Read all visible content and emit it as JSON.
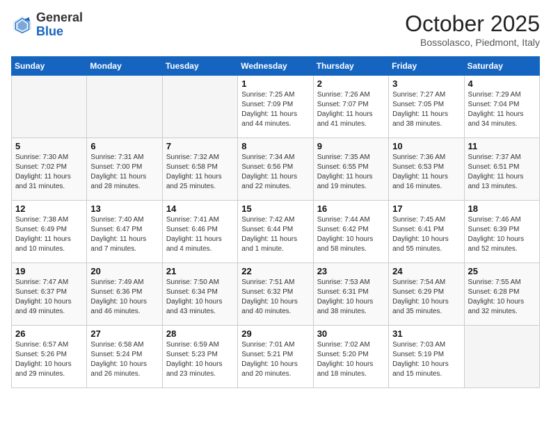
{
  "header": {
    "logo_general": "General",
    "logo_blue": "Blue",
    "month_title": "October 2025",
    "location": "Bossolasco, Piedmont, Italy"
  },
  "days_of_week": [
    "Sunday",
    "Monday",
    "Tuesday",
    "Wednesday",
    "Thursday",
    "Friday",
    "Saturday"
  ],
  "weeks": [
    [
      {
        "day": "",
        "sunrise": "",
        "sunset": "",
        "daylight": ""
      },
      {
        "day": "",
        "sunrise": "",
        "sunset": "",
        "daylight": ""
      },
      {
        "day": "",
        "sunrise": "",
        "sunset": "",
        "daylight": ""
      },
      {
        "day": "1",
        "sunrise": "Sunrise: 7:25 AM",
        "sunset": "Sunset: 7:09 PM",
        "daylight": "Daylight: 11 hours and 44 minutes."
      },
      {
        "day": "2",
        "sunrise": "Sunrise: 7:26 AM",
        "sunset": "Sunset: 7:07 PM",
        "daylight": "Daylight: 11 hours and 41 minutes."
      },
      {
        "day": "3",
        "sunrise": "Sunrise: 7:27 AM",
        "sunset": "Sunset: 7:05 PM",
        "daylight": "Daylight: 11 hours and 38 minutes."
      },
      {
        "day": "4",
        "sunrise": "Sunrise: 7:29 AM",
        "sunset": "Sunset: 7:04 PM",
        "daylight": "Daylight: 11 hours and 34 minutes."
      }
    ],
    [
      {
        "day": "5",
        "sunrise": "Sunrise: 7:30 AM",
        "sunset": "Sunset: 7:02 PM",
        "daylight": "Daylight: 11 hours and 31 minutes."
      },
      {
        "day": "6",
        "sunrise": "Sunrise: 7:31 AM",
        "sunset": "Sunset: 7:00 PM",
        "daylight": "Daylight: 11 hours and 28 minutes."
      },
      {
        "day": "7",
        "sunrise": "Sunrise: 7:32 AM",
        "sunset": "Sunset: 6:58 PM",
        "daylight": "Daylight: 11 hours and 25 minutes."
      },
      {
        "day": "8",
        "sunrise": "Sunrise: 7:34 AM",
        "sunset": "Sunset: 6:56 PM",
        "daylight": "Daylight: 11 hours and 22 minutes."
      },
      {
        "day": "9",
        "sunrise": "Sunrise: 7:35 AM",
        "sunset": "Sunset: 6:55 PM",
        "daylight": "Daylight: 11 hours and 19 minutes."
      },
      {
        "day": "10",
        "sunrise": "Sunrise: 7:36 AM",
        "sunset": "Sunset: 6:53 PM",
        "daylight": "Daylight: 11 hours and 16 minutes."
      },
      {
        "day": "11",
        "sunrise": "Sunrise: 7:37 AM",
        "sunset": "Sunset: 6:51 PM",
        "daylight": "Daylight: 11 hours and 13 minutes."
      }
    ],
    [
      {
        "day": "12",
        "sunrise": "Sunrise: 7:38 AM",
        "sunset": "Sunset: 6:49 PM",
        "daylight": "Daylight: 11 hours and 10 minutes."
      },
      {
        "day": "13",
        "sunrise": "Sunrise: 7:40 AM",
        "sunset": "Sunset: 6:47 PM",
        "daylight": "Daylight: 11 hours and 7 minutes."
      },
      {
        "day": "14",
        "sunrise": "Sunrise: 7:41 AM",
        "sunset": "Sunset: 6:46 PM",
        "daylight": "Daylight: 11 hours and 4 minutes."
      },
      {
        "day": "15",
        "sunrise": "Sunrise: 7:42 AM",
        "sunset": "Sunset: 6:44 PM",
        "daylight": "Daylight: 11 hours and 1 minute."
      },
      {
        "day": "16",
        "sunrise": "Sunrise: 7:44 AM",
        "sunset": "Sunset: 6:42 PM",
        "daylight": "Daylight: 10 hours and 58 minutes."
      },
      {
        "day": "17",
        "sunrise": "Sunrise: 7:45 AM",
        "sunset": "Sunset: 6:41 PM",
        "daylight": "Daylight: 10 hours and 55 minutes."
      },
      {
        "day": "18",
        "sunrise": "Sunrise: 7:46 AM",
        "sunset": "Sunset: 6:39 PM",
        "daylight": "Daylight: 10 hours and 52 minutes."
      }
    ],
    [
      {
        "day": "19",
        "sunrise": "Sunrise: 7:47 AM",
        "sunset": "Sunset: 6:37 PM",
        "daylight": "Daylight: 10 hours and 49 minutes."
      },
      {
        "day": "20",
        "sunrise": "Sunrise: 7:49 AM",
        "sunset": "Sunset: 6:36 PM",
        "daylight": "Daylight: 10 hours and 46 minutes."
      },
      {
        "day": "21",
        "sunrise": "Sunrise: 7:50 AM",
        "sunset": "Sunset: 6:34 PM",
        "daylight": "Daylight: 10 hours and 43 minutes."
      },
      {
        "day": "22",
        "sunrise": "Sunrise: 7:51 AM",
        "sunset": "Sunset: 6:32 PM",
        "daylight": "Daylight: 10 hours and 40 minutes."
      },
      {
        "day": "23",
        "sunrise": "Sunrise: 7:53 AM",
        "sunset": "Sunset: 6:31 PM",
        "daylight": "Daylight: 10 hours and 38 minutes."
      },
      {
        "day": "24",
        "sunrise": "Sunrise: 7:54 AM",
        "sunset": "Sunset: 6:29 PM",
        "daylight": "Daylight: 10 hours and 35 minutes."
      },
      {
        "day": "25",
        "sunrise": "Sunrise: 7:55 AM",
        "sunset": "Sunset: 6:28 PM",
        "daylight": "Daylight: 10 hours and 32 minutes."
      }
    ],
    [
      {
        "day": "26",
        "sunrise": "Sunrise: 6:57 AM",
        "sunset": "Sunset: 5:26 PM",
        "daylight": "Daylight: 10 hours and 29 minutes."
      },
      {
        "day": "27",
        "sunrise": "Sunrise: 6:58 AM",
        "sunset": "Sunset: 5:24 PM",
        "daylight": "Daylight: 10 hours and 26 minutes."
      },
      {
        "day": "28",
        "sunrise": "Sunrise: 6:59 AM",
        "sunset": "Sunset: 5:23 PM",
        "daylight": "Daylight: 10 hours and 23 minutes."
      },
      {
        "day": "29",
        "sunrise": "Sunrise: 7:01 AM",
        "sunset": "Sunset: 5:21 PM",
        "daylight": "Daylight: 10 hours and 20 minutes."
      },
      {
        "day": "30",
        "sunrise": "Sunrise: 7:02 AM",
        "sunset": "Sunset: 5:20 PM",
        "daylight": "Daylight: 10 hours and 18 minutes."
      },
      {
        "day": "31",
        "sunrise": "Sunrise: 7:03 AM",
        "sunset": "Sunset: 5:19 PM",
        "daylight": "Daylight: 10 hours and 15 minutes."
      },
      {
        "day": "",
        "sunrise": "",
        "sunset": "",
        "daylight": ""
      }
    ]
  ]
}
